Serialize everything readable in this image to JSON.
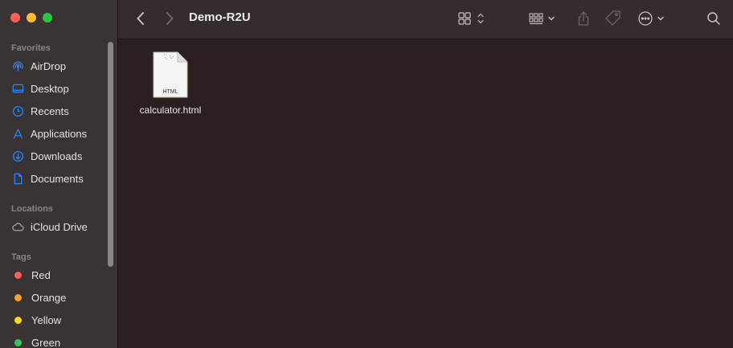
{
  "window": {
    "title": "Demo-R2U"
  },
  "sidebar": {
    "favorites_heading": "Favorites",
    "favorites": [
      {
        "label": "AirDrop",
        "icon": "airdrop-icon"
      },
      {
        "label": "Desktop",
        "icon": "desktop-icon"
      },
      {
        "label": "Recents",
        "icon": "clock-icon"
      },
      {
        "label": "Applications",
        "icon": "applications-icon"
      },
      {
        "label": "Downloads",
        "icon": "download-icon"
      },
      {
        "label": "Documents",
        "icon": "document-icon"
      }
    ],
    "locations_heading": "Locations",
    "locations": [
      {
        "label": "iCloud Drive",
        "icon": "cloud-icon"
      }
    ],
    "tags_heading": "Tags",
    "tags": [
      {
        "label": "Red",
        "color": "#fe5f57"
      },
      {
        "label": "Orange",
        "color": "#f7a12c"
      },
      {
        "label": "Yellow",
        "color": "#f5d823"
      },
      {
        "label": "Green",
        "color": "#34c759"
      }
    ]
  },
  "files": [
    {
      "name": "calculator.html",
      "type_badge": "HTML"
    }
  ],
  "colors": {
    "accent": "#2f88ff",
    "sidebar_bg": "#3a3333",
    "content_bg": "#2b2020"
  }
}
